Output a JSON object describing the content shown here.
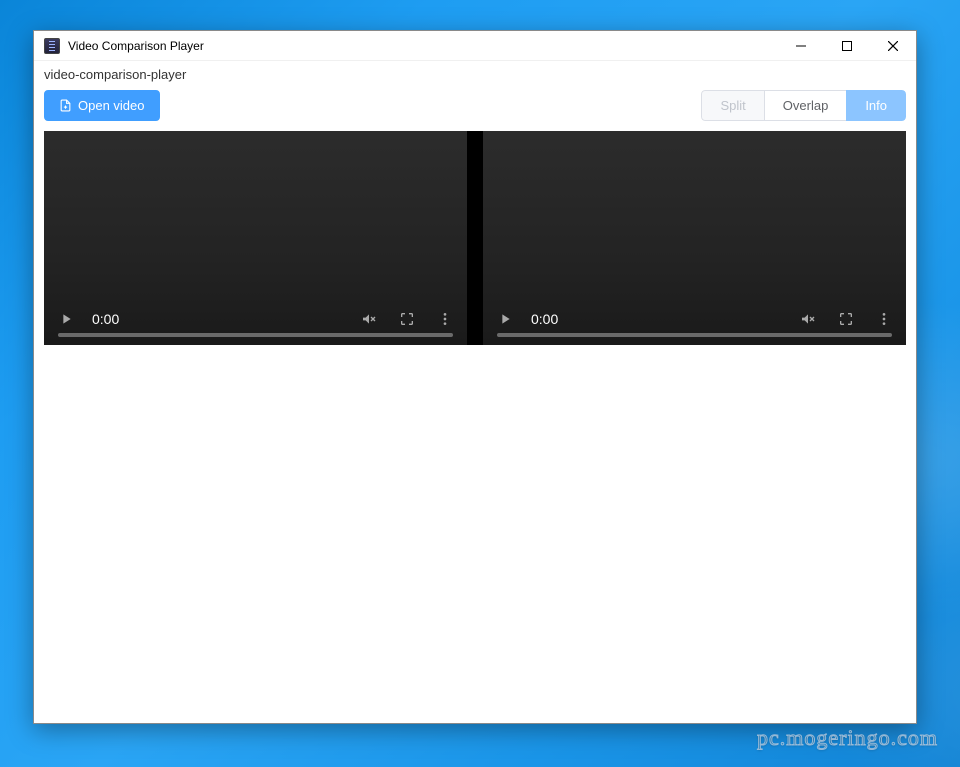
{
  "window": {
    "title": "Video Comparison Player"
  },
  "header": {
    "subtitle": "video-comparison-player"
  },
  "toolbar": {
    "open_video": "Open video",
    "tabs": {
      "split": "Split",
      "overlap": "Overlap",
      "info": "Info"
    }
  },
  "players": {
    "left": {
      "time": "0:00"
    },
    "right": {
      "time": "0:00"
    }
  },
  "watermark": "pc.mogeringo.com"
}
